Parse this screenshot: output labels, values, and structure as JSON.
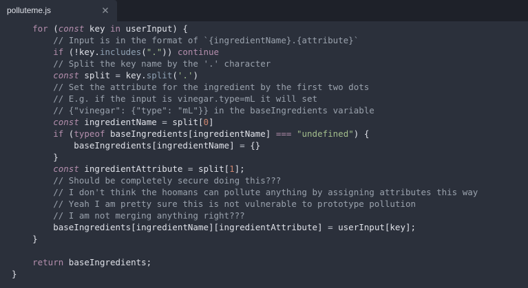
{
  "tab": {
    "title": "polluteme.js",
    "close_icon": "close-icon"
  },
  "theme": {
    "background": "#2b303b",
    "tab_bar": "#1e2129",
    "keyword": "#b48ead",
    "comment": "#9aa2ad",
    "string": "#a3be8c",
    "function": "#8fa1b3",
    "number": "#d08770",
    "text": "#dfe1e8"
  },
  "code": [
    [
      {
        "t": "    ",
        "c": "id"
      },
      {
        "t": "for",
        "c": "kw"
      },
      {
        "t": " (",
        "c": "id"
      },
      {
        "t": "const",
        "c": "it"
      },
      {
        "t": " key ",
        "c": "id"
      },
      {
        "t": "in",
        "c": "kw"
      },
      {
        "t": " userInput) {",
        "c": "id"
      }
    ],
    [
      {
        "t": "        // Input is in the format of `{ingredientName}.{attribute}`",
        "c": "cm"
      }
    ],
    [
      {
        "t": "        ",
        "c": "id"
      },
      {
        "t": "if",
        "c": "kw"
      },
      {
        "t": " (!key.",
        "c": "id"
      },
      {
        "t": "includes",
        "c": "fn"
      },
      {
        "t": "(",
        "c": "id"
      },
      {
        "t": "\".\"",
        "c": "str"
      },
      {
        "t": ")) ",
        "c": "id"
      },
      {
        "t": "continue",
        "c": "kw"
      }
    ],
    [
      {
        "t": "        // Split the key name by the '.' character",
        "c": "cm"
      }
    ],
    [
      {
        "t": "        ",
        "c": "id"
      },
      {
        "t": "const",
        "c": "it"
      },
      {
        "t": " split ",
        "c": "id"
      },
      {
        "t": "=",
        "c": "op"
      },
      {
        "t": " key.",
        "c": "id"
      },
      {
        "t": "split",
        "c": "fn"
      },
      {
        "t": "(",
        "c": "id"
      },
      {
        "t": "'.'",
        "c": "str"
      },
      {
        "t": ")",
        "c": "id"
      }
    ],
    [
      {
        "t": "        // Set the attribute for the ingredient by the first two dots",
        "c": "cm"
      }
    ],
    [
      {
        "t": "        // E.g. if the input is vinegar.type=mL it will set",
        "c": "cm"
      }
    ],
    [
      {
        "t": "        // {\"vinegar\": {\"type\": \"mL\"}} in the baseIngredients variable",
        "c": "cm"
      }
    ],
    [
      {
        "t": "        ",
        "c": "id"
      },
      {
        "t": "const",
        "c": "it"
      },
      {
        "t": " ingredientName ",
        "c": "id"
      },
      {
        "t": "=",
        "c": "op"
      },
      {
        "t": " split[",
        "c": "id"
      },
      {
        "t": "0",
        "c": "num"
      },
      {
        "t": "]",
        "c": "id"
      }
    ],
    [
      {
        "t": "        ",
        "c": "id"
      },
      {
        "t": "if",
        "c": "kw"
      },
      {
        "t": " (",
        "c": "id"
      },
      {
        "t": "typeof",
        "c": "kw"
      },
      {
        "t": " baseIngredients[ingredientName] ",
        "c": "id"
      },
      {
        "t": "===",
        "c": "kw"
      },
      {
        "t": " ",
        "c": "id"
      },
      {
        "t": "\"undefined\"",
        "c": "str"
      },
      {
        "t": ") {",
        "c": "id"
      }
    ],
    [
      {
        "t": "            baseIngredients[ingredientName] ",
        "c": "id"
      },
      {
        "t": "=",
        "c": "op"
      },
      {
        "t": " {}",
        "c": "id"
      }
    ],
    [
      {
        "t": "        }",
        "c": "id"
      }
    ],
    [
      {
        "t": "        ",
        "c": "id"
      },
      {
        "t": "const",
        "c": "it"
      },
      {
        "t": " ingredientAttribute ",
        "c": "id"
      },
      {
        "t": "=",
        "c": "op"
      },
      {
        "t": " split[",
        "c": "id"
      },
      {
        "t": "1",
        "c": "num"
      },
      {
        "t": "];",
        "c": "id"
      }
    ],
    [
      {
        "t": "        // Should be completely secure doing this???",
        "c": "cm"
      }
    ],
    [
      {
        "t": "        // I don't think the hoomans can pollute anything by assigning attributes this way",
        "c": "cm"
      }
    ],
    [
      {
        "t": "        // Yeah I am pretty sure this is not vulnerable to prototype pollution",
        "c": "cm"
      }
    ],
    [
      {
        "t": "        // I am not merging anything right???",
        "c": "cm"
      }
    ],
    [
      {
        "t": "        baseIngredients[ingredientName][ingredientAttribute] ",
        "c": "id"
      },
      {
        "t": "=",
        "c": "op"
      },
      {
        "t": " userInput[key];",
        "c": "id"
      }
    ],
    [
      {
        "t": "    }",
        "c": "id"
      }
    ],
    [
      {
        "t": "",
        "c": "id"
      }
    ],
    [
      {
        "t": "    ",
        "c": "id"
      },
      {
        "t": "return",
        "c": "kw"
      },
      {
        "t": " baseIngredients;",
        "c": "id"
      }
    ],
    [
      {
        "t": "}",
        "c": "id"
      }
    ]
  ]
}
